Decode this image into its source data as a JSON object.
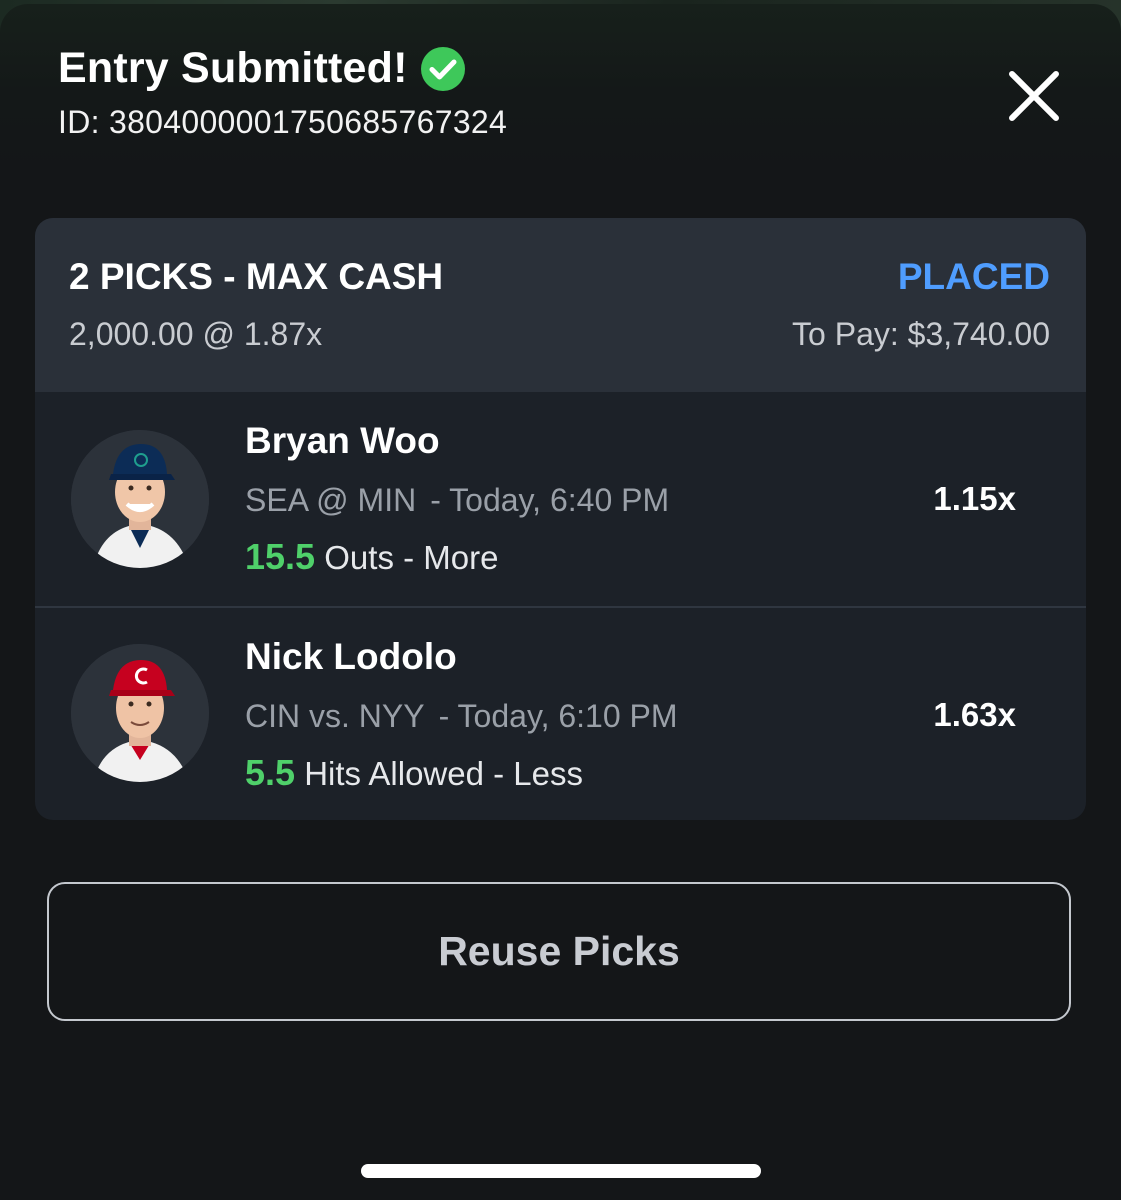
{
  "header": {
    "title": "Entry Submitted!",
    "check_icon": "check-circle-icon",
    "entry_id": "ID: 3804000001750685767324",
    "close_icon": "close-icon"
  },
  "entry": {
    "type_label": "2 PICKS - MAX CASH",
    "status": "PLACED",
    "stake_line": "2,000.00 @ 1.87x",
    "payout_line": "To Pay: $3,740.00",
    "status_color": "#4f9dff"
  },
  "picks": [
    {
      "player": "Bryan Woo",
      "matchup": "SEA @ MIN",
      "time": "- Today, 6:40 PM",
      "line_value": "15.5",
      "stat_text": "Outs - More",
      "multiplier": "1.15x",
      "team_color": "#0c2c56",
      "avatar_icon": "player-headshot-icon"
    },
    {
      "player": "Nick Lodolo",
      "matchup": "CIN vs. NYY",
      "time": "- Today, 6:10 PM",
      "line_value": "5.5",
      "stat_text": "Hits Allowed - Less",
      "multiplier": "1.63x",
      "team_color": "#c6011f",
      "avatar_icon": "player-headshot-icon"
    }
  ],
  "actions": {
    "reuse_label": "Reuse Picks"
  },
  "colors": {
    "accent_green": "#4fd06a",
    "accent_blue": "#4f9dff",
    "background": "#141618",
    "card": "#1c2128",
    "card_header": "#2a3039"
  }
}
